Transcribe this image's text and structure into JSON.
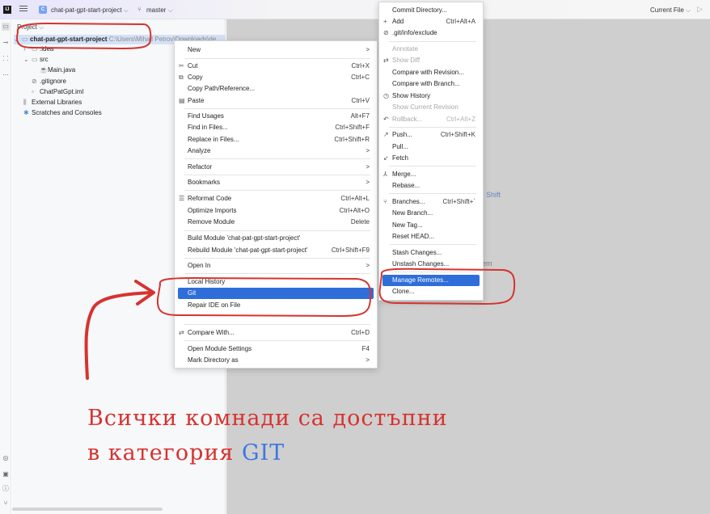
{
  "titlebar": {
    "logo": "IJ",
    "project_badge": "C",
    "project_name": "chat-pat-gpt-start-project",
    "branch": "master",
    "current_file": "Current File"
  },
  "project_panel": {
    "header": "Project",
    "root_name": "chat-pat-gpt-start-project",
    "root_path": "C:\\Users\\Mihail Petrov\\Downloads\\de",
    "tree": [
      ".idea",
      "src",
      "Main.java",
      ".gitignore",
      "ChatPatGpt.iml",
      "External Libraries",
      "Scratches and Consoles"
    ]
  },
  "editor": {
    "ghost_text_1": "Shift",
    "ghost_text_2": "em"
  },
  "context_menu": {
    "items": [
      {
        "label": "New",
        "shortcut": ">"
      },
      {
        "label": "Cut",
        "shortcut": "Ctrl+X"
      },
      {
        "label": "Copy",
        "shortcut": "Ctrl+C"
      },
      {
        "label": "Copy Path/Reference...",
        "shortcut": ""
      },
      {
        "label": "Paste",
        "shortcut": "Ctrl+V"
      },
      {
        "label": "Find Usages",
        "shortcut": "Alt+F7"
      },
      {
        "label": "Find in Files...",
        "shortcut": "Ctrl+Shift+F"
      },
      {
        "label": "Replace in Files...",
        "shortcut": "Ctrl+Shift+R"
      },
      {
        "label": "Analyze",
        "shortcut": ">"
      },
      {
        "label": "Refactor",
        "shortcut": ">"
      },
      {
        "label": "Bookmarks",
        "shortcut": ">"
      },
      {
        "label": "Reformat Code",
        "shortcut": "Ctrl+Alt+L"
      },
      {
        "label": "Optimize Imports",
        "shortcut": "Ctrl+Alt+O"
      },
      {
        "label": "Remove Module",
        "shortcut": "Delete"
      },
      {
        "label": "Build Module 'chat-pat-gpt-start-project'",
        "shortcut": ""
      },
      {
        "label": "Rebuild Module 'chat-pat-gpt-start-project'",
        "shortcut": "Ctrl+Shift+F9"
      },
      {
        "label": "Open In",
        "shortcut": ">"
      },
      {
        "label": "Local History",
        "shortcut": ""
      },
      {
        "label": "Git",
        "shortcut": ""
      },
      {
        "label": "Repair IDE on File",
        "shortcut": ""
      },
      {
        "label": "Compare With...",
        "shortcut": "Ctrl+D"
      },
      {
        "label": "Open Module Settings",
        "shortcut": "F4"
      },
      {
        "label": "Mark Directory as",
        "shortcut": ">"
      }
    ]
  },
  "git_submenu": {
    "items": [
      {
        "label": "Commit Directory...",
        "shortcut": ""
      },
      {
        "label": "Add",
        "shortcut": "Ctrl+Alt+A"
      },
      {
        "label": ".git/info/exclude",
        "shortcut": ""
      },
      {
        "label": "Annotate",
        "shortcut": ""
      },
      {
        "label": "Show Diff",
        "shortcut": ""
      },
      {
        "label": "Compare with Revision...",
        "shortcut": ""
      },
      {
        "label": "Compare with Branch...",
        "shortcut": ""
      },
      {
        "label": "Show History",
        "shortcut": ""
      },
      {
        "label": "Show Current Revision",
        "shortcut": ""
      },
      {
        "label": "Rollback...",
        "shortcut": "Ctrl+Alt+Z"
      },
      {
        "label": "Push...",
        "shortcut": "Ctrl+Shift+K"
      },
      {
        "label": "Pull...",
        "shortcut": ""
      },
      {
        "label": "Fetch",
        "shortcut": ""
      },
      {
        "label": "Merge...",
        "shortcut": ""
      },
      {
        "label": "Rebase...",
        "shortcut": ""
      },
      {
        "label": "Branches...",
        "shortcut": "Ctrl+Shift+`"
      },
      {
        "label": "New Branch...",
        "shortcut": ""
      },
      {
        "label": "New Tag...",
        "shortcut": ""
      },
      {
        "label": "Reset HEAD...",
        "shortcut": ""
      },
      {
        "label": "Stash Changes...",
        "shortcut": ""
      },
      {
        "label": "Unstash Changes...",
        "shortcut": ""
      },
      {
        "label": "Manage Remotes...",
        "shortcut": ""
      },
      {
        "label": "Clone...",
        "shortcut": ""
      }
    ]
  },
  "annotation": {
    "line1": "Всички комнади са достъпни",
    "line2_prefix": "в категория ",
    "line2_highlight": "GIT"
  },
  "colors": {
    "selection": "#2f6ed9",
    "annotation_red": "#d6332f",
    "annotation_blue": "#3d77e0",
    "editor_bg": "#cfcfcf"
  }
}
